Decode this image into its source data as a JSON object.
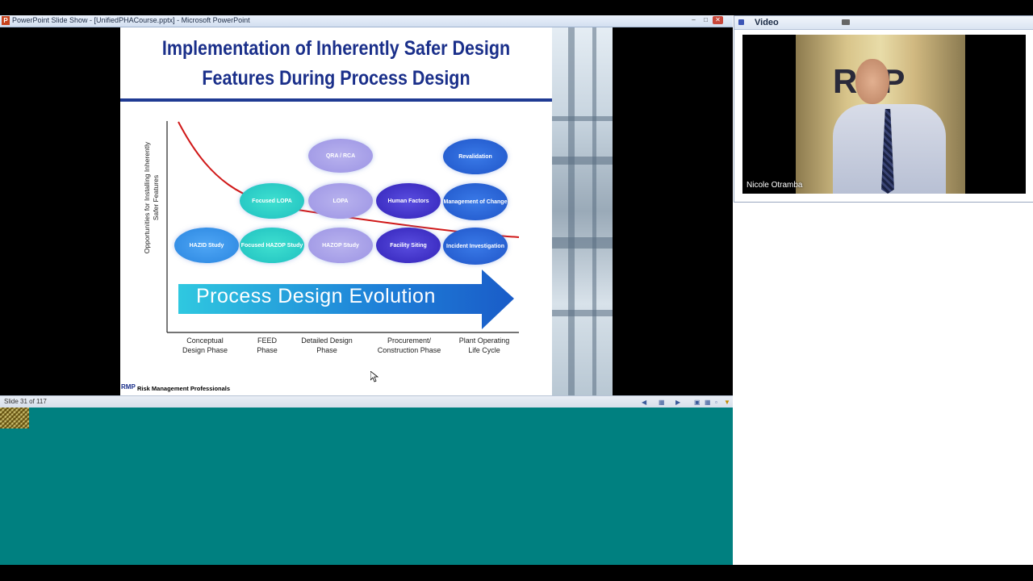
{
  "window": {
    "title": "PowerPoint Slide Show - [UnifiedPHACourse.pptx] - Microsoft PowerPoint",
    "app_icon": "P"
  },
  "slide": {
    "title_line1": "Implementation of Inherently Safer Design",
    "title_line2": "Features During Process Design",
    "y_axis_label": "Opportunities for Installing Inherently Safer Features",
    "arrow_text": "Process Design Evolution",
    "phases": [
      {
        "line1": "Conceptual",
        "line2": "Design Phase"
      },
      {
        "line1": "FEED",
        "line2": "Phase"
      },
      {
        "line1": "Detailed Design",
        "line2": "Phase"
      },
      {
        "line1": "Procurement/",
        "line2": "Construction Phase"
      },
      {
        "line1": "Plant Operating",
        "line2": "Life Cycle"
      }
    ],
    "bubbles": {
      "qra": "QRA / RCA",
      "revalidation": "Revalidation",
      "focused_lopa": "Focused LOPA",
      "lopa": "LOPA",
      "human_factors": "Human Factors",
      "moc": "Management of Change",
      "hazid": "HAZID Study",
      "focused_hazop": "Focused HAZOP Study",
      "hazop": "HAZOP Study",
      "facility_siting": "Facility Siting",
      "incident": "Incident Investigation"
    },
    "footer_logo": "RMP",
    "footer_text": "Risk Management Professionals"
  },
  "statusbar": {
    "slide_count": "Slide 31 of 117"
  },
  "video": {
    "panel_title": "Video",
    "backdrop_text": "RMP",
    "presenter_name": "Nicole Otramba"
  }
}
